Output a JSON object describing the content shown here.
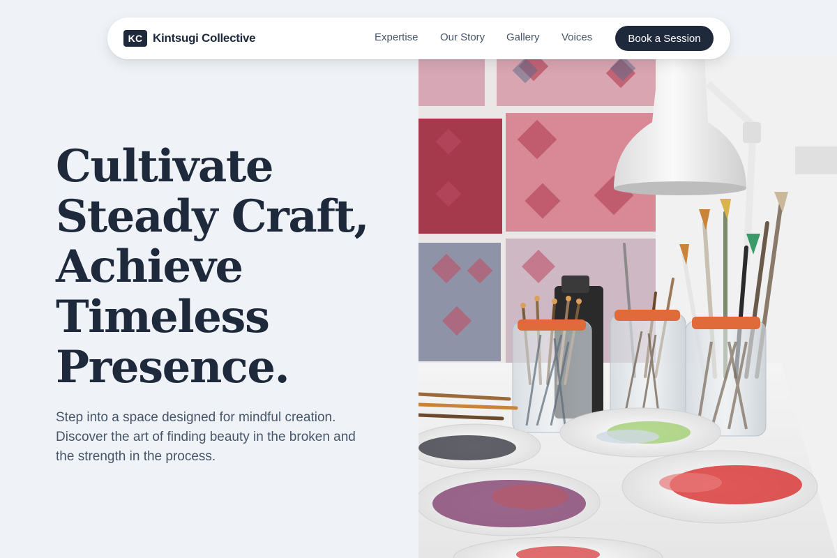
{
  "brand": {
    "badge": "KC",
    "name": "Kintsugi Collective"
  },
  "nav": {
    "links": [
      "Expertise",
      "Our Story",
      "Gallery",
      "Voices"
    ],
    "cta": "Book a Session"
  },
  "hero": {
    "heading_lines": [
      "Cultivate",
      "Steady Craft,",
      "Achieve",
      "Timeless",
      "Presence."
    ],
    "subtitle": "Step into a space designed for mindful creation. Discover the art of finding beauty in the broken and the strength in the process."
  },
  "image": {
    "subject": "Art studio table with jars of paint brushes, paint palettes and a white desk lamp"
  },
  "colors": {
    "background": "#eff3f7",
    "ink": "#1e293b",
    "muted": "#475569",
    "navbar": "#ffffff"
  }
}
